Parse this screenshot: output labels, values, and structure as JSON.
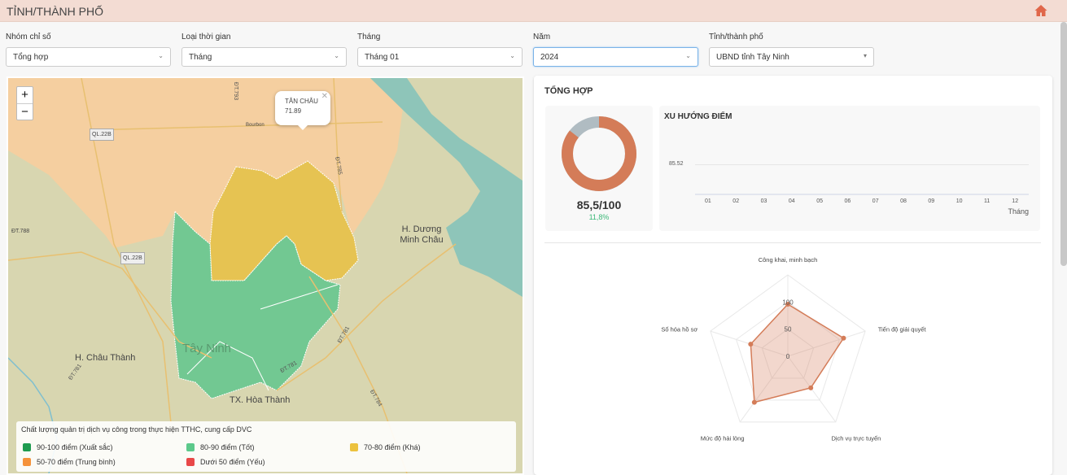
{
  "header": {
    "title": "TỈNH/THÀNH PHỐ",
    "icon": "home-icon",
    "accent": "#e0674a"
  },
  "filters": [
    {
      "label": "Nhóm chỉ số",
      "value": "Tổng hợp"
    },
    {
      "label": "Loại thời gian",
      "value": "Tháng"
    },
    {
      "label": "Tháng",
      "value": "Tháng 01"
    },
    {
      "label": "Năm",
      "value": "2024"
    },
    {
      "label": "Tỉnh/thành phố",
      "value": "UBND tỉnh Tây Ninh"
    }
  ],
  "map": {
    "zoom_in": "+",
    "zoom_out": "−",
    "popup": {
      "name": "TÂN CHÂU",
      "value": "71.89"
    },
    "labels": {
      "duong_minh_chau": "H. Dương Minh Châu",
      "chau_thanh": "H. Châu Thành",
      "tay_ninh": "Tây Ninh",
      "hoa_thanh": "TX. Hòa Thành",
      "ql22b": "QL.22B",
      "dt788": "ĐT.788",
      "dt781": "ĐT.781",
      "dt784": "ĐT.784",
      "dt785": "ĐT.785",
      "dt793": "ĐT.793",
      "bourbon": "Bourbon"
    },
    "legend": {
      "title": "Chất lượng quản trị dịch vụ công trong thực hiện TTHC, cung cấp DVC",
      "items": [
        {
          "label": "90-100 điểm (Xuất sắc)",
          "color": "#1e9b4f"
        },
        {
          "label": "80-90 điểm (Tốt)",
          "color": "#5cc98b"
        },
        {
          "label": "70-80 điểm (Khá)",
          "color": "#ecc23e"
        },
        {
          "label": "50-70 điểm (Trung bình)",
          "color": "#f5923a"
        },
        {
          "label": "Dưới 50 điểm (Yếu)",
          "color": "#e84848"
        }
      ]
    }
  },
  "summary": {
    "title": "TỔNG HỢP",
    "score": "85,5/100",
    "change": "11,8%",
    "donut": {
      "value": 85.5,
      "max": 100,
      "color": "#d47c58",
      "rest_color": "#b0bcc2"
    },
    "trend": {
      "title": "XU HƯỚNG ĐIỂM",
      "y_tick": "85.52",
      "x_ticks": [
        "01",
        "02",
        "03",
        "04",
        "05",
        "06",
        "07",
        "08",
        "09",
        "10",
        "11",
        "12"
      ],
      "x_label": "Tháng"
    }
  },
  "chart_data": {
    "type": "radar",
    "axes": [
      "Công khai, minh bạch",
      "Tiến độ giải quyết",
      "Dịch vụ trực tuyến",
      "Mức độ hài lòng",
      "Số hóa hồ sơ"
    ],
    "values": [
      96,
      108,
      72,
      105,
      72
    ],
    "ticks": [
      "0",
      "50",
      "100"
    ],
    "range": [
      0,
      150
    ],
    "color": "#d47c58"
  }
}
